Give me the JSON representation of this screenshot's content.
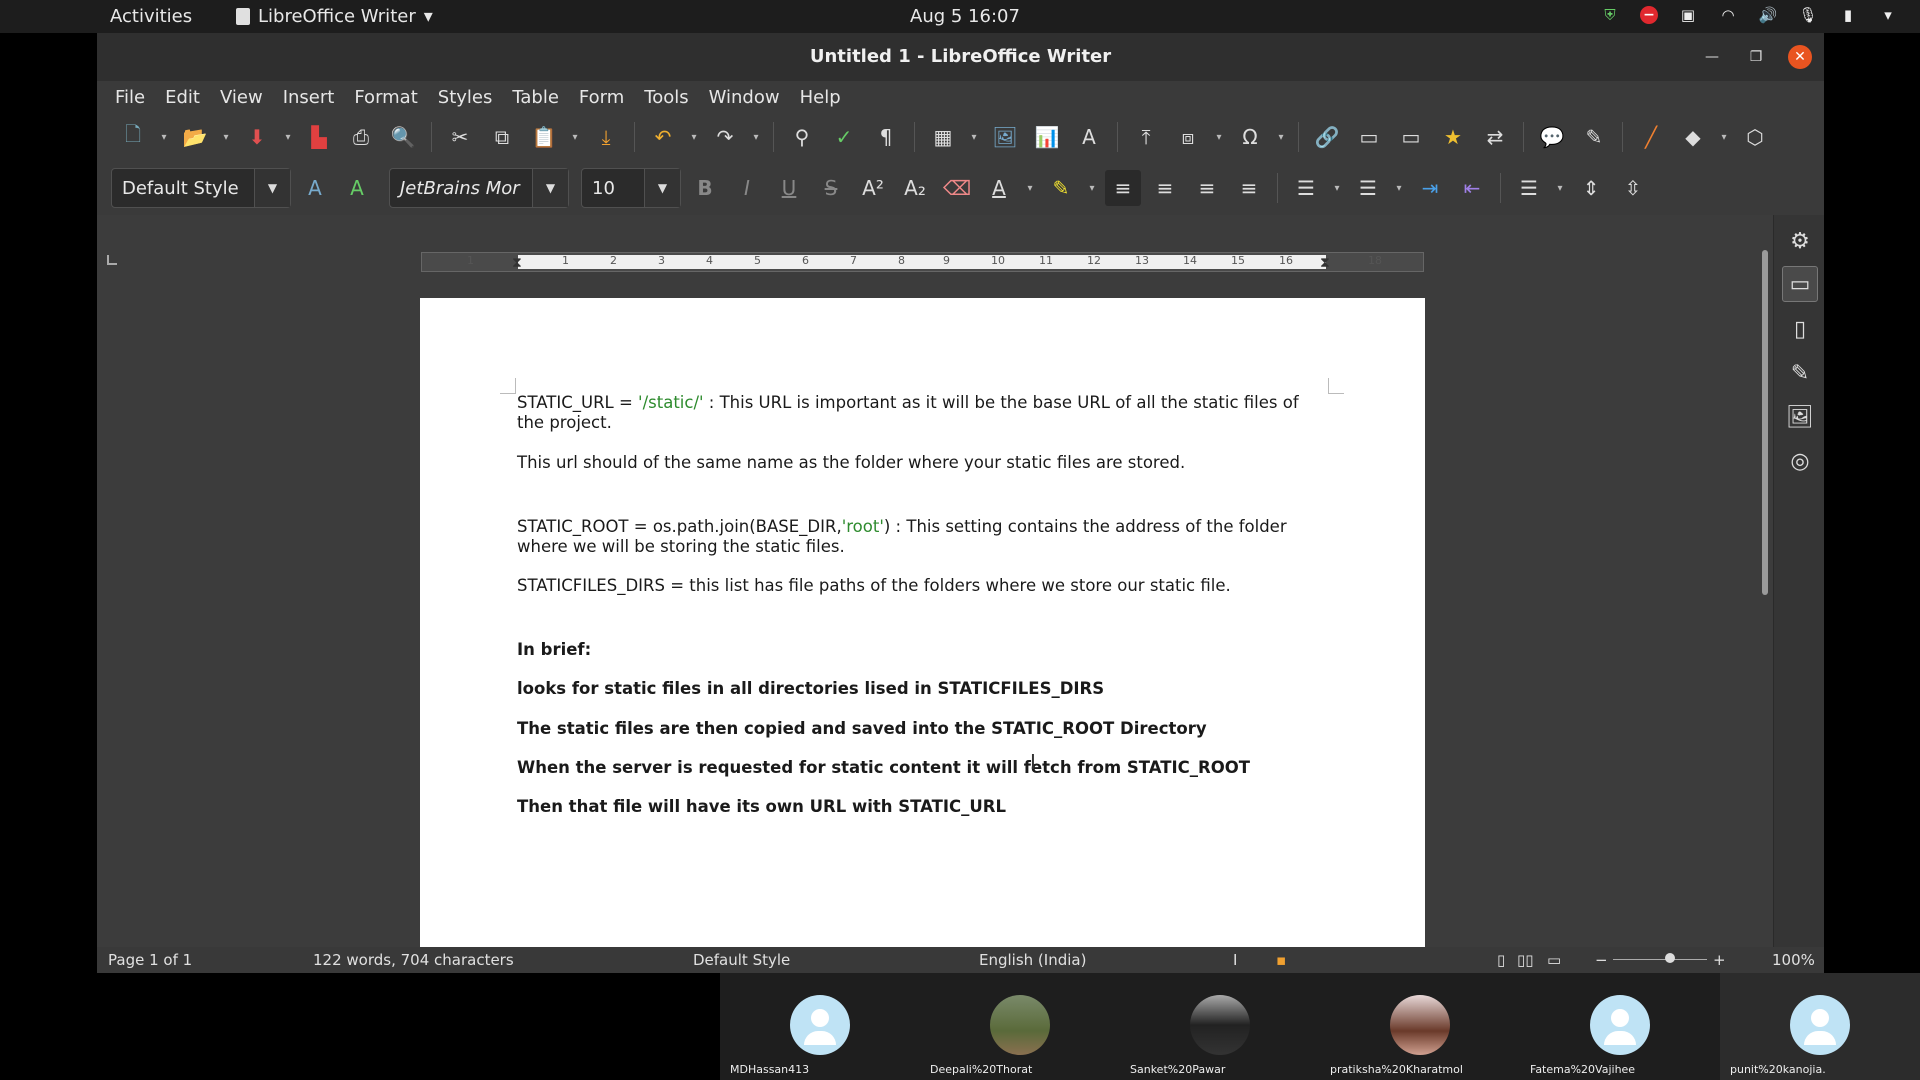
{
  "topbar": {
    "activities": "Activities",
    "app_name": "LibreOffice Writer",
    "clock": "Aug 5  16:07"
  },
  "window": {
    "title": "Untitled 1 - LibreOffice Writer"
  },
  "menu": [
    "File",
    "Edit",
    "View",
    "Insert",
    "Format",
    "Styles",
    "Table",
    "Form",
    "Tools",
    "Window",
    "Help"
  ],
  "formatting": {
    "paragraph_style": "Default Style",
    "font_name": "JetBrains Mor",
    "font_size": "10"
  },
  "ruler": {
    "numbers": [
      "1",
      "1",
      "2",
      "3",
      "4",
      "5",
      "6",
      "7",
      "8",
      "9",
      "10",
      "11",
      "12",
      "13",
      "14",
      "15",
      "16",
      "18"
    ]
  },
  "document": {
    "p1_a": "STATIC_URL = ",
    "p1_green": "'/static/'",
    "p1_b": " :  This URL is important as it will be the base URL of all the static files of the project.",
    "p2": "This url should of the same name as the folder where your static files are stored.",
    "p3_a": "STATIC_ROOT = os.path.join(BASE_DIR,",
    "p3_green": "'root'",
    "p3_b": ") : This setting contains the address of the folder where we will be storing the static files.",
    "p4": "STATICFILES_DIRS = this list has file paths of the folders where we store our static file.",
    "brief": "In brief:",
    "b1": "looks for static files in all directories lised in STATICFILES_DIRS",
    "b2": "The static files are then copied and saved into the STATIC_ROOT Directory",
    "b3": "When the server is requested for static content it will fetch from STATIC_ROOT",
    "b4": "Then that file will have its own URL with STATIC_URL"
  },
  "statusbar": {
    "page": "Page 1 of 1",
    "words": "122 words, 704 characters",
    "style": "Default Style",
    "language": "English (India)",
    "zoom": "100%"
  },
  "participants": [
    {
      "name": "MDHassan413",
      "avatar": "default"
    },
    {
      "name": "Deepali%20Thorat",
      "avatar": "photo"
    },
    {
      "name": "Sanket%20Pawar",
      "avatar": "photo"
    },
    {
      "name": "pratiksha%20Kharatmol",
      "avatar": "photo"
    },
    {
      "name": "Fatema%20Vajihee",
      "avatar": "default"
    },
    {
      "name": "punit%20kanojia.",
      "avatar": "default"
    }
  ]
}
